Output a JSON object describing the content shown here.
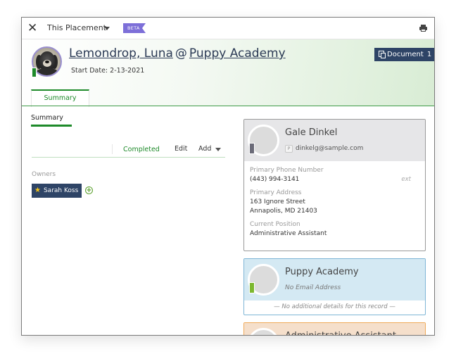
{
  "topbar": {
    "close_icon": "close-x-icon",
    "title": "This Placement",
    "beta_label": "BETA",
    "print_icon": "printer-icon"
  },
  "header": {
    "candidate_name": "Lemondrop, Luna",
    "separator": "@",
    "company_name": "Puppy Academy",
    "start_date": "Start Date: 2-13-2021",
    "status_color": "#1e8a2a",
    "document_button": {
      "label": "Document",
      "count": "1"
    }
  },
  "tabs": [
    {
      "label": "Summary",
      "active": true
    }
  ],
  "summary": {
    "section_title": "Summary",
    "status": "Completed",
    "edit_label": "Edit",
    "add_label": "Add",
    "owners_label": "Owners",
    "owners": [
      {
        "name": "Sarah Koss",
        "primary": true
      }
    ]
  },
  "cards": {
    "contact": {
      "name": "Gale Dinkel",
      "email_badge": "P",
      "email": "dinkelg@sample.com",
      "status_color": "#6b6b78",
      "fields": [
        {
          "label": "Primary Phone Number",
          "value": "(443) 994-3141",
          "ext": "ext"
        },
        {
          "label": "Primary Address",
          "line1": "163 Ignore Street",
          "line2": "Annapolis, MD 21403"
        },
        {
          "label": "Current Position",
          "value": "Administrative Assistant"
        }
      ]
    },
    "company": {
      "name": "Puppy Academy",
      "email": "No Email Address",
      "status_color": "#7cb82f",
      "no_details": "— No additional details for this record —"
    },
    "position": {
      "name": "Administrative Assistant"
    }
  },
  "colors": {
    "accent_green": "#1e8a2a",
    "navy": "#2e4466",
    "beta_purple": "#7d6fd8"
  }
}
